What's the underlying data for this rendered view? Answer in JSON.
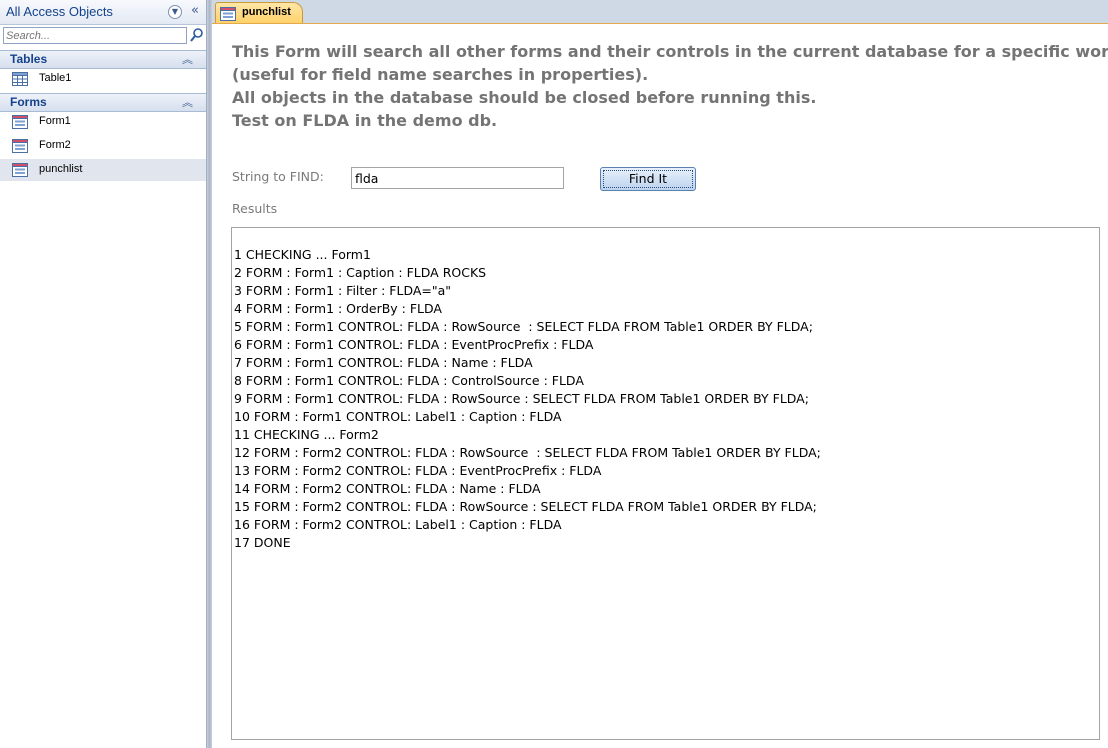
{
  "nav": {
    "title": "All Access Objects",
    "search_placeholder": "Search...",
    "groups": [
      {
        "title": "Tables",
        "items": [
          {
            "label": "Table1",
            "icon": "table-icon"
          }
        ]
      },
      {
        "title": "Forms",
        "items": [
          {
            "label": "Form1",
            "icon": "form-icon"
          },
          {
            "label": "Form2",
            "icon": "form-icon"
          },
          {
            "label": "punchlist",
            "icon": "form-icon",
            "selected": true
          }
        ]
      }
    ]
  },
  "tab": {
    "label": "punchlist",
    "icon": "form-icon"
  },
  "form": {
    "intro_lines": [
      "This Form will search all other forms and their controls in the current database for a specific word",
      "(useful for field name searches in properties).",
      "All objects in the database should be closed before running this.",
      "Test on FLDA in the demo db."
    ],
    "find_label": "String to FIND:",
    "find_value": "flda",
    "find_button": "Find It",
    "results_label": "Results",
    "results": [
      "1 CHECKING ... Form1",
      "2 FORM : Form1 : Caption : FLDA ROCKS",
      "3 FORM : Form1 : Filter : FLDA=\"a\"",
      "4 FORM : Form1 : OrderBy : FLDA",
      "5 FORM : Form1 CONTROL: FLDA : RowSource  : SELECT FLDA FROM Table1 ORDER BY FLDA;",
      "6 FORM : Form1 CONTROL: FLDA : EventProcPrefix : FLDA",
      "7 FORM : Form1 CONTROL: FLDA : Name : FLDA",
      "8 FORM : Form1 CONTROL: FLDA : ControlSource : FLDA",
      "9 FORM : Form1 CONTROL: FLDA : RowSource : SELECT FLDA FROM Table1 ORDER BY FLDA;",
      "10 FORM : Form1 CONTROL: Label1 : Caption : FLDA",
      "11 CHECKING ... Form2",
      "12 FORM : Form2 CONTROL: FLDA : RowSource  : SELECT FLDA FROM Table1 ORDER BY FLDA;",
      "13 FORM : Form2 CONTROL: FLDA : EventProcPrefix : FLDA",
      "14 FORM : Form2 CONTROL: FLDA : Name : FLDA",
      "15 FORM : Form2 CONTROL: FLDA : RowSource : SELECT FLDA FROM Table1 ORDER BY FLDA;",
      "16 FORM : Form2 CONTROL: Label1 : Caption : FLDA",
      "17 DONE"
    ]
  }
}
